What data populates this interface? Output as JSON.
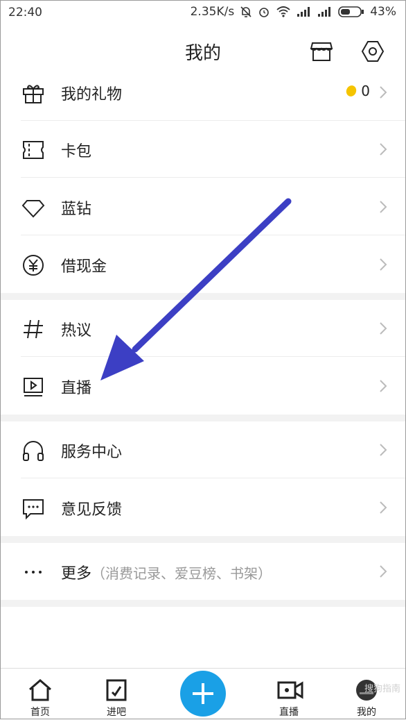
{
  "status": {
    "time": "22:40",
    "speed": "2.35K/s",
    "battery": "43%"
  },
  "header": {
    "title": "我的",
    "store_icon": "store-icon",
    "settings_icon": "settings-icon"
  },
  "menu": {
    "gifts": {
      "label": "我的礼物",
      "count": "0"
    },
    "card": {
      "label": "卡包"
    },
    "diamond": {
      "label": "蓝钻"
    },
    "cash": {
      "label": "借现金"
    },
    "topic": {
      "label": "热议"
    },
    "live": {
      "label": "直播"
    },
    "service": {
      "label": "服务中心"
    },
    "feedback": {
      "label": "意见反馈"
    },
    "more": {
      "label": "更多",
      "sub": "（消费记录、爱豆榜、书架）"
    }
  },
  "tabs": {
    "home": "首页",
    "bar": "进吧",
    "live": "直播",
    "mine": "我的"
  },
  "watermark": "搜狗指南",
  "colors": {
    "accent": "#1aa0e6",
    "arrow": "#3c3fc4",
    "coin": "#f5c400"
  }
}
